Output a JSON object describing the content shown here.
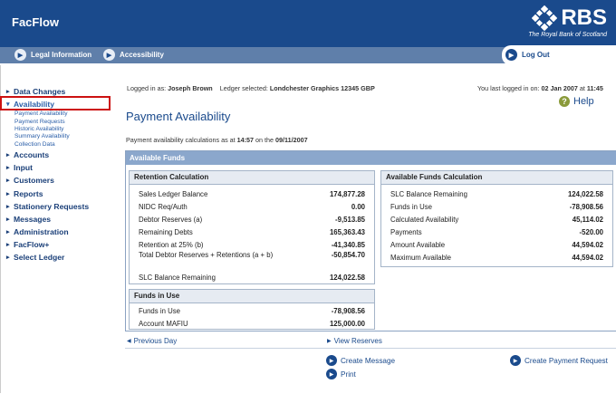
{
  "app": {
    "name": "FacFlow"
  },
  "brand": {
    "logo_text": "RBS",
    "logo_subtitle": "The Royal Bank of Scotland"
  },
  "nav": {
    "legal": "Legal Information",
    "accessibility": "Accessibility",
    "logout": "Log Out"
  },
  "sidebar": {
    "items": [
      {
        "label": "Data Changes"
      },
      {
        "label": "Availability"
      },
      {
        "label": "Accounts"
      },
      {
        "label": "Input"
      },
      {
        "label": "Customers"
      },
      {
        "label": "Reports"
      },
      {
        "label": "Stationery Requests"
      },
      {
        "label": "Messages"
      },
      {
        "label": "Administration"
      },
      {
        "label": "FacFlow+"
      },
      {
        "label": "Select Ledger"
      }
    ],
    "availability_sub": [
      "Payment Availability",
      "Payment Requests",
      "Historic Availability",
      "Summary Availability",
      "Collection Data"
    ]
  },
  "info": {
    "logged_in_label": "Logged in as:",
    "user": "Joseph Brown",
    "ledger_label": "Ledger selected:",
    "ledger": "Londchester Graphics",
    "ledger_no": "12345",
    "currency": "GBP",
    "last_login_label": "You last logged in on:",
    "last_login_date": "02 Jan 2007",
    "at_word": "at",
    "last_login_time": "11:45"
  },
  "page": {
    "title": "Payment Availability",
    "help": "Help",
    "calc_prefix": "Payment availability calculations as at",
    "calc_time": "14:57",
    "calc_on": "on the",
    "calc_date": "09/11/2007"
  },
  "panel": {
    "title": "Available Funds"
  },
  "retention": {
    "title": "Retention Calculation",
    "rows": [
      {
        "label": "Sales Ledger Balance",
        "value": "174,877.28"
      },
      {
        "label": "NIDC Req/Auth",
        "value": "0.00"
      },
      {
        "label": "Debtor Reserves (a)",
        "value": "-9,513.85"
      },
      {
        "label": "Remaining Debts",
        "value": "165,363.43"
      },
      {
        "label": "Retention at 25% (b)",
        "value": "-41,340.85"
      },
      {
        "label": "Total Debtor Reserves + Retentions (a + b)",
        "value": "-50,854.70"
      },
      {
        "label": "SLC Balance Remaining",
        "value": "124,022.58"
      }
    ]
  },
  "funds_in_use": {
    "title": "Funds in Use",
    "rows": [
      {
        "label": "Funds in Use",
        "value": "-78,908.56"
      },
      {
        "label": "Account MAFIU",
        "value": "125,000.00"
      }
    ]
  },
  "available_calc": {
    "title": "Available Funds Calculation",
    "rows": [
      {
        "label": "SLC Balance Remaining",
        "value": "124,022.58"
      },
      {
        "label": "Funds in Use",
        "value": "-78,908.56"
      },
      {
        "label": "Calculated Availability",
        "value": "45,114.02"
      },
      {
        "label": "Payments",
        "value": "-520.00"
      },
      {
        "label": "Amount Available",
        "value": "44,594.02"
      },
      {
        "label": "Maximum Available",
        "value": "44,594.02"
      }
    ]
  },
  "links": {
    "previous_day": "Previous Day",
    "view_reserves": "View Reserves"
  },
  "actions": {
    "create_message": "Create Message",
    "print": "Print",
    "create_payment_request": "Create Payment Request"
  },
  "colors": {
    "header": "#1a4a8c",
    "navbar": "#5f7faa",
    "highlight_box": "#cc1111"
  }
}
